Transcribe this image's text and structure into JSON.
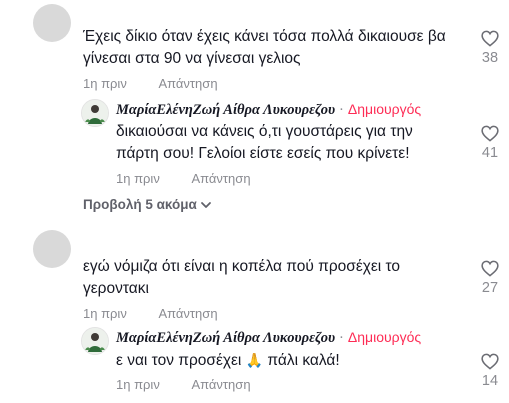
{
  "comments": [
    {
      "username_partial": "",
      "text_line1": "Έχεις δίκιο όταν έχεις κάνει τόσα πολλά δικαιουσε βα",
      "text_line2": "γίνεσαι στα 90 να γίνεσαι γελιος",
      "time": "1η πριν",
      "reply_label": "Απάντηση",
      "likes": "38",
      "reply": {
        "username": "ΜαρίαΕλένηΖωή Αίθρα Λυκουρεζου",
        "separator": "·",
        "creator_badge": "Δημιουργός",
        "text_line1": "δικαιούσαι να κάνεις ό,τι γουστάρεις για την",
        "text_line2": "πάρτη σου! Γελοίοι είστε εσείς που κρίνετε!",
        "time": "1η πριν",
        "reply_label": "Απάντηση",
        "likes": "41"
      },
      "view_more": "Προβολή 5 ακόμα"
    },
    {
      "username_partial": "",
      "text_line1": "εγώ νόμιζα ότι είναι η κοπέλα πού προσέχει το",
      "text_line2": "γεροντακι",
      "time": "1η πριν",
      "reply_label": "Απάντηση",
      "likes": "27",
      "reply": {
        "username": "ΜαρίαΕλένηΖωή Αίθρα Λυκουρεζου",
        "separator": "·",
        "creator_badge": "Δημιουργός",
        "text_line1": "ε ναι τον προσέχει",
        "text_emoji": "🙏",
        "text_line1_end": " πάλι καλά!",
        "time": "1η πριν",
        "reply_label": "Απάντηση",
        "likes": "14"
      }
    }
  ],
  "icons": {
    "like": "heart-outline-icon",
    "expand": "chevron-down-icon"
  },
  "colors": {
    "creator_badge": "#fe2c55",
    "meta_text": "#8a8b91",
    "primary_text": "#161823"
  }
}
